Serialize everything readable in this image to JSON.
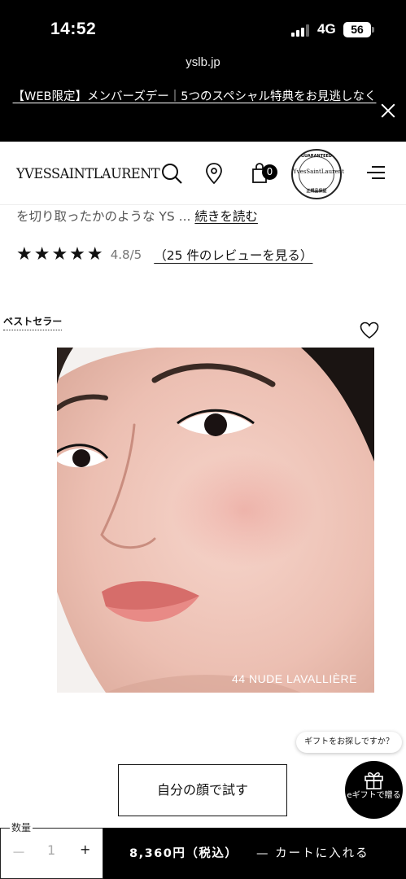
{
  "status": {
    "time": "14:52",
    "network": "4G",
    "battery": "56"
  },
  "browser": {
    "url": "yslb.jp"
  },
  "promo": {
    "text": "【WEB限定】メンバーズデー｜5つのスペシャル特典をお見逃しなく"
  },
  "header": {
    "logo": "YVESSAINTLAURENT",
    "cart_count": "0",
    "seal": {
      "top": "GUARANTEED",
      "middle": "YvesSaintLaurent",
      "bottom": "正規品保証"
    }
  },
  "product": {
    "description_snippet": "を切り取ったかのような YS ...",
    "read_more": "続きを読む",
    "stars": "★★★★★",
    "rating": "4.8/5",
    "reviews_link": "（25 件のレビューを見る）",
    "badge": "ベストセラー",
    "shade_name": "44 NUDE LAVALLIÈRE"
  },
  "actions": {
    "gift_prompt": "ギフトをお探しですか？",
    "try_on": "自分の顔で試す",
    "gift_button": "eギフトで贈る",
    "quantity_label": "数量",
    "quantity_minus": "－",
    "quantity_value": "1",
    "quantity_plus": "+",
    "price": "8,360円（税込）",
    "add_to_cart": "— カートに入れる"
  },
  "colors": {
    "black": "#000000",
    "white": "#ffffff",
    "accent": "#111111"
  }
}
